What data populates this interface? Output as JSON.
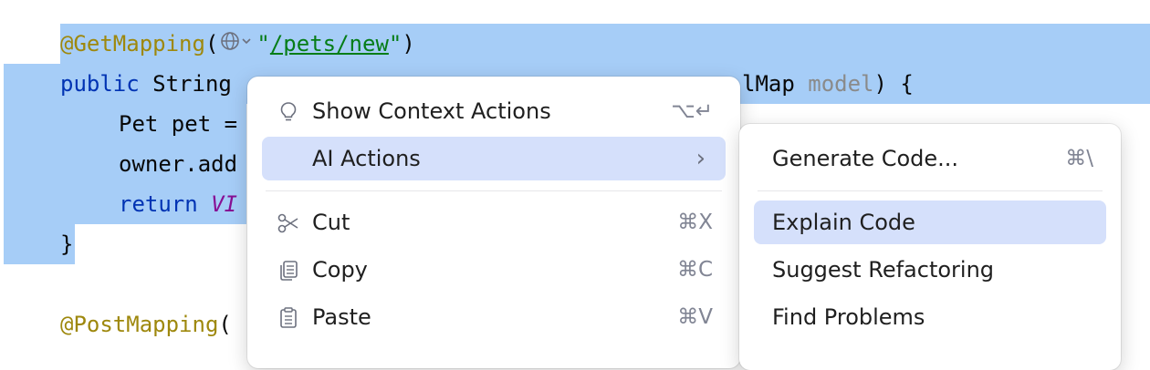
{
  "editor": {
    "selection_color": "#a6cdf7",
    "lines": {
      "l1": {
        "annotation": "@GetMapping",
        "open_paren": "(",
        "inlay_icon": "globe-icon",
        "quote_open": "\"",
        "url": "/pets/new",
        "quote_close": "\"",
        "close_paren": ")"
      },
      "l2": {
        "keyword": "public",
        "type": " String ",
        "param_type": "lMap ",
        "param": "model",
        "tail": ") {"
      },
      "l3": {
        "text": "Pet pet ="
      },
      "l4": {
        "text": "owner.add"
      },
      "l5": {
        "keyword": "return",
        "constant": "VI"
      },
      "l6": {
        "text": "}"
      },
      "l8": {
        "annotation": "@PostMapping",
        "open_paren": "("
      }
    }
  },
  "context_menu": {
    "show_context_actions": {
      "label": "Show Context Actions",
      "shortcut": "⌥↵",
      "icon": "lightbulb-icon"
    },
    "ai_actions": {
      "label": "AI Actions",
      "submenu_arrow": "›"
    },
    "cut": {
      "label": "Cut",
      "shortcut": "⌘X",
      "icon": "scissors-icon"
    },
    "copy": {
      "label": "Copy",
      "shortcut": "⌘C",
      "icon": "copy-icon"
    },
    "paste": {
      "label": "Paste",
      "shortcut": "⌘V",
      "icon": "clipboard-icon"
    }
  },
  "ai_submenu": {
    "generate_code": {
      "label": "Generate Code...",
      "shortcut": "⌘\\"
    },
    "explain_code": {
      "label": "Explain Code"
    },
    "suggest_refactoring": {
      "label": "Suggest Refactoring"
    },
    "find_problems": {
      "label": "Find Problems"
    }
  },
  "colors": {
    "accent_highlight": "#d5e0fb",
    "annotation": "#9e880d",
    "keyword": "#0033b3",
    "string": "#067d17",
    "constant": "#871094"
  }
}
